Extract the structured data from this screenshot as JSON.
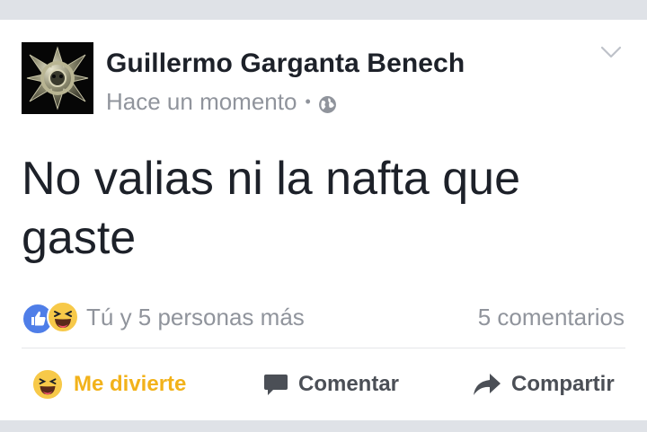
{
  "post": {
    "author": "Guillermo Garganta Benech",
    "timestamp": "Hace un momento",
    "separator": "•",
    "privacy_icon": "globe-icon",
    "menu_icon": "chevron-down-icon",
    "text": "No valias ni la nafta que gaste"
  },
  "reactions": {
    "icons": [
      "like-icon",
      "haha-icon"
    ],
    "summary": "Tú y 5 personas más",
    "comments": "5 comentarios"
  },
  "actions": {
    "react_label": "Me divierte",
    "comment_label": "Comentar",
    "share_label": "Compartir"
  },
  "colors": {
    "reacted": "#f2b21a",
    "like_blue": "#4f7ee8",
    "text_primary": "#1d2129",
    "text_secondary": "#90949c",
    "page_background": "#dfe2e7"
  }
}
